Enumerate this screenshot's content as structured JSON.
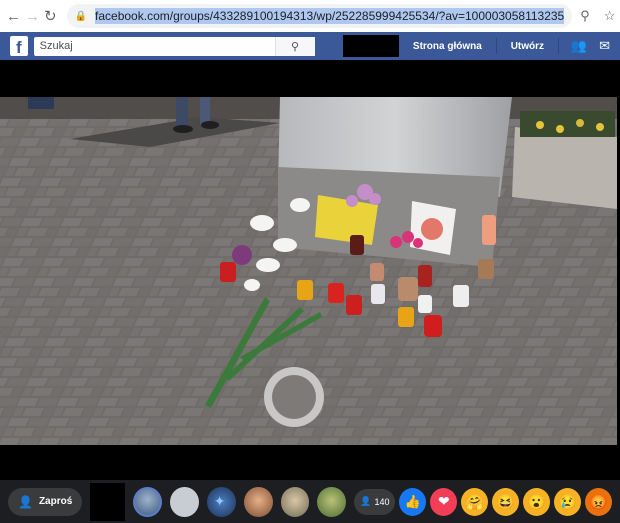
{
  "browser": {
    "url": "facebook.com/groups/433289100194313/wp/252285999425534/?av=100003058113235",
    "icons": [
      "back-arrow-icon",
      "forward-arrow-icon",
      "reload-icon",
      "lock-icon",
      "zoom-icon",
      "star-icon"
    ]
  },
  "fb_header": {
    "logo": "f",
    "search_placeholder": "Szukaj",
    "home_label": "Strona główna",
    "create_label": "Utwórz"
  },
  "video": {
    "description": "street memorial: candles, flowers, paper sign at base of concrete pillar"
  },
  "bottom_bar": {
    "invite_label": "Zaproś",
    "viewer_count": "140",
    "reactions": [
      "like",
      "love",
      "care",
      "haha",
      "wow",
      "sad",
      "angry"
    ]
  }
}
